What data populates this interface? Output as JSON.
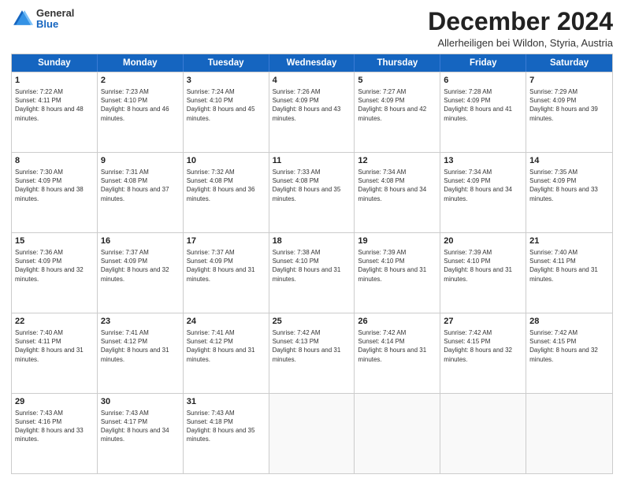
{
  "logo": {
    "general": "General",
    "blue": "Blue"
  },
  "title": "December 2024",
  "location": "Allerheiligen bei Wildon, Styria, Austria",
  "header_days": [
    "Sunday",
    "Monday",
    "Tuesday",
    "Wednesday",
    "Thursday",
    "Friday",
    "Saturday"
  ],
  "weeks": [
    [
      {
        "day": "1",
        "rise": "Sunrise: 7:22 AM",
        "set": "Sunset: 4:11 PM",
        "daylight": "Daylight: 8 hours and 48 minutes."
      },
      {
        "day": "2",
        "rise": "Sunrise: 7:23 AM",
        "set": "Sunset: 4:10 PM",
        "daylight": "Daylight: 8 hours and 46 minutes."
      },
      {
        "day": "3",
        "rise": "Sunrise: 7:24 AM",
        "set": "Sunset: 4:10 PM",
        "daylight": "Daylight: 8 hours and 45 minutes."
      },
      {
        "day": "4",
        "rise": "Sunrise: 7:26 AM",
        "set": "Sunset: 4:09 PM",
        "daylight": "Daylight: 8 hours and 43 minutes."
      },
      {
        "day": "5",
        "rise": "Sunrise: 7:27 AM",
        "set": "Sunset: 4:09 PM",
        "daylight": "Daylight: 8 hours and 42 minutes."
      },
      {
        "day": "6",
        "rise": "Sunrise: 7:28 AM",
        "set": "Sunset: 4:09 PM",
        "daylight": "Daylight: 8 hours and 41 minutes."
      },
      {
        "day": "7",
        "rise": "Sunrise: 7:29 AM",
        "set": "Sunset: 4:09 PM",
        "daylight": "Daylight: 8 hours and 39 minutes."
      }
    ],
    [
      {
        "day": "8",
        "rise": "Sunrise: 7:30 AM",
        "set": "Sunset: 4:09 PM",
        "daylight": "Daylight: 8 hours and 38 minutes."
      },
      {
        "day": "9",
        "rise": "Sunrise: 7:31 AM",
        "set": "Sunset: 4:08 PM",
        "daylight": "Daylight: 8 hours and 37 minutes."
      },
      {
        "day": "10",
        "rise": "Sunrise: 7:32 AM",
        "set": "Sunset: 4:08 PM",
        "daylight": "Daylight: 8 hours and 36 minutes."
      },
      {
        "day": "11",
        "rise": "Sunrise: 7:33 AM",
        "set": "Sunset: 4:08 PM",
        "daylight": "Daylight: 8 hours and 35 minutes."
      },
      {
        "day": "12",
        "rise": "Sunrise: 7:34 AM",
        "set": "Sunset: 4:08 PM",
        "daylight": "Daylight: 8 hours and 34 minutes."
      },
      {
        "day": "13",
        "rise": "Sunrise: 7:34 AM",
        "set": "Sunset: 4:09 PM",
        "daylight": "Daylight: 8 hours and 34 minutes."
      },
      {
        "day": "14",
        "rise": "Sunrise: 7:35 AM",
        "set": "Sunset: 4:09 PM",
        "daylight": "Daylight: 8 hours and 33 minutes."
      }
    ],
    [
      {
        "day": "15",
        "rise": "Sunrise: 7:36 AM",
        "set": "Sunset: 4:09 PM",
        "daylight": "Daylight: 8 hours and 32 minutes."
      },
      {
        "day": "16",
        "rise": "Sunrise: 7:37 AM",
        "set": "Sunset: 4:09 PM",
        "daylight": "Daylight: 8 hours and 32 minutes."
      },
      {
        "day": "17",
        "rise": "Sunrise: 7:37 AM",
        "set": "Sunset: 4:09 PM",
        "daylight": "Daylight: 8 hours and 31 minutes."
      },
      {
        "day": "18",
        "rise": "Sunrise: 7:38 AM",
        "set": "Sunset: 4:10 PM",
        "daylight": "Daylight: 8 hours and 31 minutes."
      },
      {
        "day": "19",
        "rise": "Sunrise: 7:39 AM",
        "set": "Sunset: 4:10 PM",
        "daylight": "Daylight: 8 hours and 31 minutes."
      },
      {
        "day": "20",
        "rise": "Sunrise: 7:39 AM",
        "set": "Sunset: 4:10 PM",
        "daylight": "Daylight: 8 hours and 31 minutes."
      },
      {
        "day": "21",
        "rise": "Sunrise: 7:40 AM",
        "set": "Sunset: 4:11 PM",
        "daylight": "Daylight: 8 hours and 31 minutes."
      }
    ],
    [
      {
        "day": "22",
        "rise": "Sunrise: 7:40 AM",
        "set": "Sunset: 4:11 PM",
        "daylight": "Daylight: 8 hours and 31 minutes."
      },
      {
        "day": "23",
        "rise": "Sunrise: 7:41 AM",
        "set": "Sunset: 4:12 PM",
        "daylight": "Daylight: 8 hours and 31 minutes."
      },
      {
        "day": "24",
        "rise": "Sunrise: 7:41 AM",
        "set": "Sunset: 4:12 PM",
        "daylight": "Daylight: 8 hours and 31 minutes."
      },
      {
        "day": "25",
        "rise": "Sunrise: 7:42 AM",
        "set": "Sunset: 4:13 PM",
        "daylight": "Daylight: 8 hours and 31 minutes."
      },
      {
        "day": "26",
        "rise": "Sunrise: 7:42 AM",
        "set": "Sunset: 4:14 PM",
        "daylight": "Daylight: 8 hours and 31 minutes."
      },
      {
        "day": "27",
        "rise": "Sunrise: 7:42 AM",
        "set": "Sunset: 4:15 PM",
        "daylight": "Daylight: 8 hours and 32 minutes."
      },
      {
        "day": "28",
        "rise": "Sunrise: 7:42 AM",
        "set": "Sunset: 4:15 PM",
        "daylight": "Daylight: 8 hours and 32 minutes."
      }
    ],
    [
      {
        "day": "29",
        "rise": "Sunrise: 7:43 AM",
        "set": "Sunset: 4:16 PM",
        "daylight": "Daylight: 8 hours and 33 minutes."
      },
      {
        "day": "30",
        "rise": "Sunrise: 7:43 AM",
        "set": "Sunset: 4:17 PM",
        "daylight": "Daylight: 8 hours and 34 minutes."
      },
      {
        "day": "31",
        "rise": "Sunrise: 7:43 AM",
        "set": "Sunset: 4:18 PM",
        "daylight": "Daylight: 8 hours and 35 minutes."
      },
      null,
      null,
      null,
      null
    ]
  ]
}
